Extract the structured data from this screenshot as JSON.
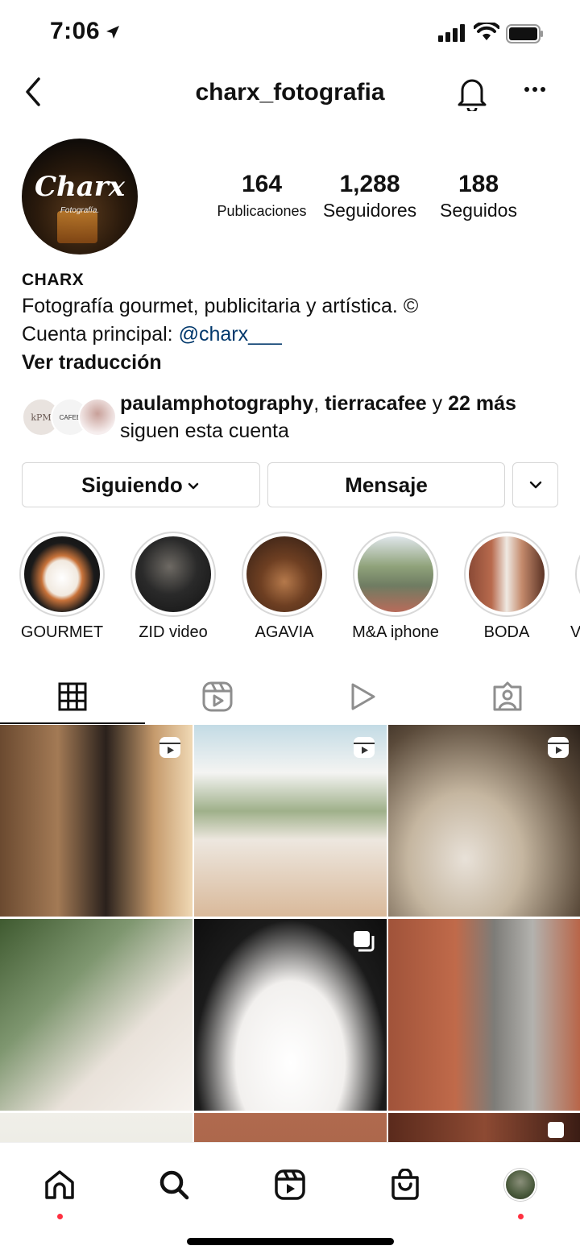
{
  "status_bar": {
    "time": "7:06"
  },
  "header": {
    "username": "charx_fotografia"
  },
  "profile": {
    "avatar_text": "Charx",
    "avatar_subtext": "Fotografía.",
    "stats": [
      {
        "value": "164",
        "label": "Publicaciones"
      },
      {
        "value": "1,288",
        "label": "Seguidores"
      },
      {
        "value": "188",
        "label": "Seguidos"
      }
    ],
    "name": "CHARX",
    "bio_line1": "Fotografía gourmet, publicitaria y artística. ©",
    "bio_line2_prefix": "Cuenta principal: ",
    "bio_line2_link": "@charx___",
    "translate": "Ver traducción"
  },
  "followed_by": {
    "user1": "paulamphotography",
    "separator": ", ",
    "user2": "tierracafee",
    "and": " y ",
    "more": "22 más",
    "suffix": "siguen esta cuenta",
    "avatar1_text": "kPM",
    "avatar2_text": "CAFEE"
  },
  "buttons": {
    "following": "Siguiendo",
    "message": "Mensaje"
  },
  "highlights": [
    {
      "label": "GOURMET"
    },
    {
      "label": "ZID video"
    },
    {
      "label": "AGAVIA"
    },
    {
      "label": "M&A iphone"
    },
    {
      "label": "BODA"
    },
    {
      "label": "V"
    }
  ],
  "tabs": [
    {
      "name": "grid",
      "active": true
    },
    {
      "name": "reels",
      "active": false
    },
    {
      "name": "videos",
      "active": false
    },
    {
      "name": "tagged",
      "active": false
    }
  ],
  "colors": {
    "link": "#00376b",
    "notification_dot": "#ff3040",
    "border": "#d6d6d6"
  }
}
